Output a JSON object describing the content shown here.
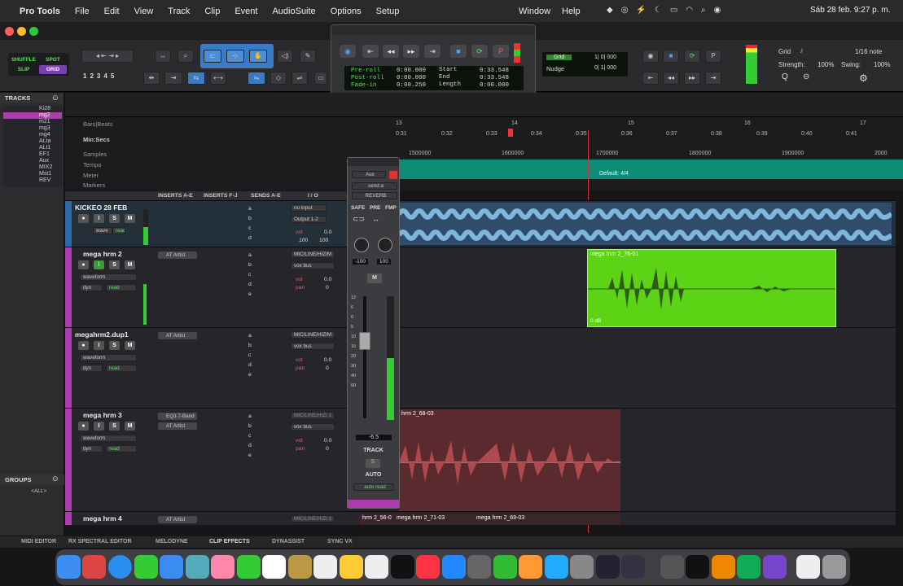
{
  "menubar": {
    "app": "Pro Tools",
    "items": [
      "File",
      "Edit",
      "View",
      "Track",
      "Clip",
      "Event",
      "AudioSuite",
      "Options",
      "Setup"
    ],
    "right_items": [
      "Window",
      "Help"
    ],
    "clock": "Sáb 28 feb. 9:27 p. m."
  },
  "toolbar": {
    "edit_modes": [
      "SHUFFLE",
      "SPOT",
      "SLIP",
      "GRID"
    ],
    "zoom_presets": [
      "1",
      "2",
      "3",
      "4",
      "5"
    ],
    "grid_label": "Grid",
    "grid_value": "1/16 note",
    "strength_label": "Strength:",
    "strength_value": "100%",
    "swing_label": "Swing:",
    "swing_value": "100%",
    "grid_mode_label": "Grid",
    "grid_counter": "1| 0| 000",
    "nudge_label": "Nudge",
    "nudge_counter": "0| 1| 000"
  },
  "transport": {
    "preroll_label": "Pre-roll",
    "preroll": "0:00.000",
    "postroll_label": "Post-roll",
    "postroll": "0:00.000",
    "fadein_label": "Fade-in",
    "fadein": "0:00.250",
    "start_label": "Start",
    "start": "0:33.548",
    "end_label": "End",
    "end": "0:33.548",
    "length_label": "Length",
    "length": "0:00.000"
  },
  "left_panel": {
    "tracks_header": "TRACKS",
    "tracks": [
      "Ki28",
      "mg2",
      "m21",
      "mg3",
      "mg4",
      "ALta",
      "ALt1",
      "EF1",
      "Aux",
      "MIX2",
      "Mst1",
      "REV"
    ],
    "groups_header": "GROUPS",
    "group_all": "<ALL>"
  },
  "rulers": {
    "bars_label": "Bars|Beats",
    "minsecs_label": "Min:Secs",
    "samples_label": "Samples",
    "tempo_label": "Tempo",
    "meter_label": "Meter",
    "markers_label": "Markers",
    "meter_value": "Default: 4/4",
    "bars": [
      "13",
      "14",
      "15",
      "16",
      "17"
    ],
    "mins": [
      "0:31",
      "0:32",
      "0:33",
      "0:34",
      "0:35",
      "0:36",
      "0:37",
      "0:38",
      "0:39",
      "0:40",
      "0:41"
    ],
    "samples": [
      "1500000",
      "1600000",
      "1700000",
      "1800000",
      "1900000",
      "2000"
    ]
  },
  "edit_columns": [
    "INSERTS A-E",
    "INSERTS F-J",
    "SENDS A-E",
    "I / O"
  ],
  "tracks": [
    {
      "name": "KICKEO 28 FEB",
      "view": "wave",
      "auto": "read",
      "input": "no input",
      "output": "Output 1-2",
      "vol": "0.0",
      "pan_l": "100",
      "pan_r": "100",
      "insert": ""
    },
    {
      "name": "mega hrm 2",
      "view": "waveform",
      "auto": "read",
      "input": "MIC/LINE/HIZ/M",
      "output": "vox bus",
      "vol": "0.0",
      "pan": "0",
      "insert": "AT Artist",
      "extra": "dyn"
    },
    {
      "name": "megahrm2.dup1",
      "view": "waveform",
      "auto": "read",
      "input": "MIC/LINE/HIZ/M",
      "output": "vox bus",
      "vol": "0.0",
      "pan": "0",
      "insert": "AT Artist",
      "extra": "dyn"
    },
    {
      "name": "mega hrm 3",
      "view": "waveform",
      "auto": "read",
      "input": "MIC/LINE/HIZ/ 1",
      "output": "vox bus",
      "vol": "0.0",
      "pan": "0",
      "insert": "EQ3 7-Band",
      "insert2": "AT Artist",
      "extra": "dyn"
    },
    {
      "name": "mega hrm 4",
      "insert": "AT Artist",
      "input": "MIC/LINE/HIZ/ 1"
    }
  ],
  "send_letters": [
    "a",
    "b",
    "c",
    "d",
    "e"
  ],
  "clips": {
    "green": "mega hrm 2_76-01",
    "green_gain": "0 dB",
    "red": "hrm 2_68-03",
    "bottom1": "hrm 2_56-0",
    "bottom2": "mega hrm 2_71-03",
    "bottom3": "mega hrm 2_69-03"
  },
  "aux": {
    "type": "Aux",
    "send": "send a",
    "bus": "REVERB",
    "safe": "SAFE",
    "pre": "PRE",
    "fmp": "FMP",
    "pan_l": "-100",
    "pan_r": "100",
    "m": "M",
    "fader_value": "-6.5",
    "track_label": "TRACK",
    "auto_label": "AUTO",
    "auto_mode": "auto read",
    "scale": [
      "12",
      "6",
      "0",
      "5",
      "10",
      "15",
      "20",
      "30",
      "40",
      "60"
    ]
  },
  "bottombar": [
    "MIDI EDITOR",
    "RX SPECTRAL EDITOR",
    "MELODYNE",
    "CLIP EFFECTS",
    "DYNASSIST",
    "SYNC VX"
  ],
  "colors": {
    "green_clip": "#5dd316",
    "red_clip": "#b0494d",
    "purple_track": "#b03ab0",
    "blue_track": "#2a6aa8",
    "tool_blue": "#3b7bc4"
  }
}
